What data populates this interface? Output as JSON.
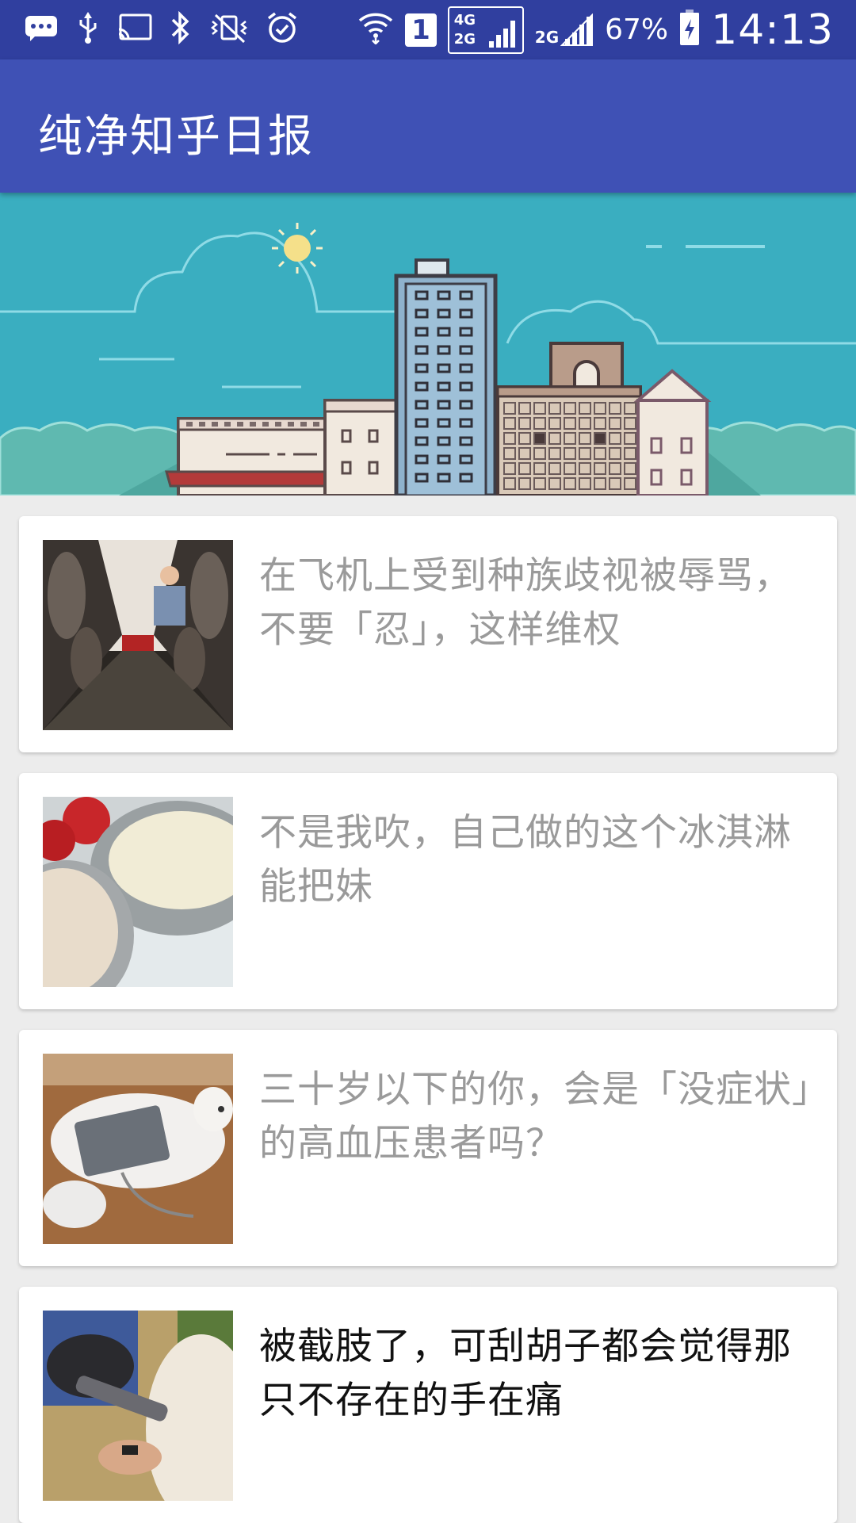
{
  "status_bar": {
    "sim_label": "1",
    "net_4g": "4G",
    "net_2g_a": "2G",
    "net_2g_b": "2G",
    "battery": "67%",
    "time": "14:13",
    "icons": [
      "message-icon",
      "usb-icon",
      "cast-icon",
      "bluetooth-icon",
      "vibrate-icon",
      "alarm-icon",
      "wifi-icon",
      "signal-icon",
      "battery-charging-icon"
    ]
  },
  "appbar": {
    "title": "纯净知乎日报"
  },
  "banner": {
    "image": "city-skyline-illustration"
  },
  "stories": [
    {
      "title": "在飞机上受到种族歧视被辱骂，不要「忍」，这样维权",
      "image": "airplane-aisle-photo",
      "read": true
    },
    {
      "title": "不是我吹，自己做的这个冰淇淋能把妹",
      "image": "ice-cream-bowls-photo",
      "read": true
    },
    {
      "title": "三十岁以下的你，会是「没症状」的高血压患者吗？",
      "image": "cat-blood-pressure-photo",
      "read": true
    },
    {
      "title": "被截肢了，可刮胡子都会觉得那只不存在的手在痛",
      "image": "prosthetic-arm-photo",
      "read": false
    }
  ],
  "colors": {
    "status_bar": "#303f9f",
    "app_bar": "#3f51b5",
    "read_text": "#9a9a9a",
    "unread_text": "#111111",
    "sky": "#3aaec0"
  }
}
